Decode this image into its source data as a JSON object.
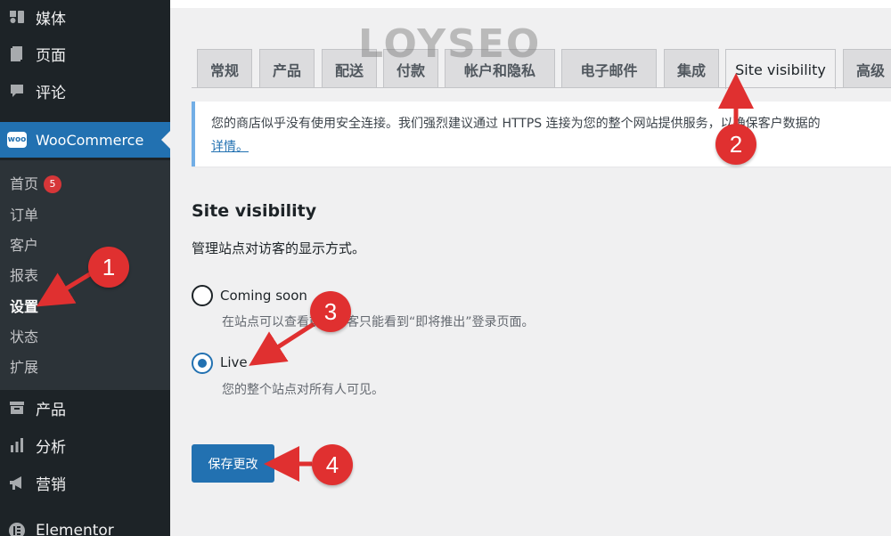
{
  "sidebar": {
    "top_items": [
      {
        "label": "媒体",
        "icon": "media-icon"
      },
      {
        "label": "页面",
        "icon": "page-icon"
      },
      {
        "label": "评论",
        "icon": "comment-icon"
      }
    ],
    "woocommerce": {
      "label": "WooCommerce",
      "logo_text": "woo"
    },
    "submenu": [
      {
        "label": "首页",
        "badge": "5"
      },
      {
        "label": "订单"
      },
      {
        "label": "客户"
      },
      {
        "label": "报表"
      },
      {
        "label": "设置",
        "active": true
      },
      {
        "label": "状态"
      },
      {
        "label": "扩展"
      }
    ],
    "bottom_items": [
      {
        "label": "产品",
        "icon": "archive-icon"
      },
      {
        "label": "分析",
        "icon": "bar-chart-icon"
      },
      {
        "label": "营销",
        "icon": "megaphone-icon"
      },
      {
        "label": "Elementor",
        "icon": "elementor-icon"
      }
    ]
  },
  "tabs": [
    "常规",
    "产品",
    "配送",
    "付款",
    "帐户和隐私",
    "电子邮件",
    "集成",
    "Site visibility",
    "高级"
  ],
  "active_tab": "Site visibility",
  "notice": {
    "text": "您的商店似乎没有使用安全连接。我们强烈建议通过 HTTPS 连接为您的整个网站提供服务，以确保客户数据的",
    "link": "详情。"
  },
  "section": {
    "title": "Site visibility",
    "description": "管理站点对访客的显示方式。"
  },
  "options": [
    {
      "label": "Coming soon",
      "description": "在站点可以查看前，访客只能看到“即将推出”登录页面。",
      "checked": false
    },
    {
      "label": "Live",
      "description": "您的整个站点对所有人可见。",
      "checked": true
    }
  ],
  "save_button": "保存更改",
  "watermark": "LOYSEO",
  "annotations": [
    "1",
    "2",
    "3",
    "4"
  ],
  "colors": {
    "sidebar_bg": "#1d2327",
    "accent": "#2271b1",
    "annotation_red": "#e03030",
    "badge_red": "#d63638"
  }
}
